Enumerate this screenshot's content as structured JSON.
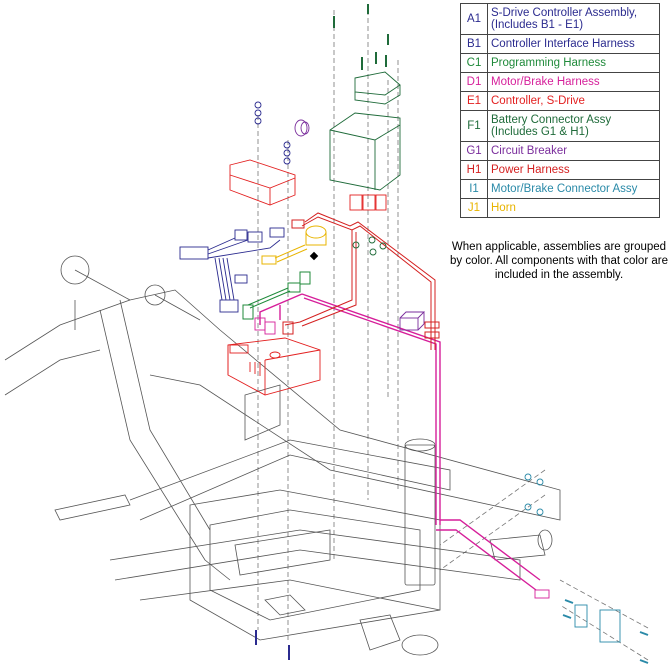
{
  "legend": {
    "rows": [
      {
        "code": "A1",
        "label": "S-Drive Controller Assembly, (Includes B1 - E1)",
        "color": "#2b2b8f"
      },
      {
        "code": "B1",
        "label": "Controller Interface Harness",
        "color": "#2b2b8f"
      },
      {
        "code": "C1",
        "label": "Programming Harness",
        "color": "#1f8a3a"
      },
      {
        "code": "D1",
        "label": "Motor/Brake Harness",
        "color": "#d61f9a"
      },
      {
        "code": "E1",
        "label": "Controller, S-Drive",
        "color": "#e32020"
      },
      {
        "code": "F1",
        "label": "Battery Connector Assy (Includes G1 & H1)",
        "color": "#1f6b3a"
      },
      {
        "code": "G1",
        "label": "Circuit Breaker",
        "color": "#7a2d9c"
      },
      {
        "code": "H1",
        "label": "Power Harness",
        "color": "#d42020"
      },
      {
        "code": "I1",
        "label": "Motor/Brake Connector Assy",
        "color": "#2a8aa8"
      },
      {
        "code": "J1",
        "label": "Horn",
        "color": "#e8b400"
      }
    ]
  },
  "note": "When applicable, assemblies are grouped by color. All components with that color are included in the assembly.",
  "colors": {
    "frame": "#555555",
    "controller_assy": "#2b2b8f",
    "programming": "#1f8a3a",
    "motor_brake": "#d61f9a",
    "controller": "#e32020",
    "battery_connector": "#1f6b3a",
    "circuit_breaker": "#7a2d9c",
    "power": "#d42020",
    "connector_assy": "#2a8aa8",
    "horn": "#e8b400"
  }
}
